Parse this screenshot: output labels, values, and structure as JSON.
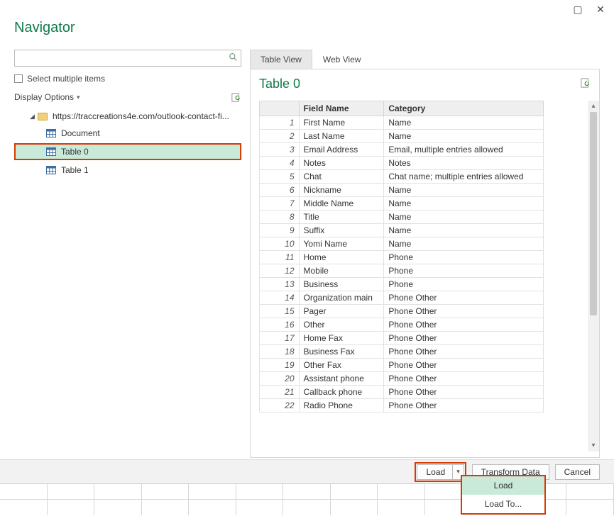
{
  "titlebar": {
    "maximize_glyph": "▢",
    "close_glyph": "✕"
  },
  "navigator": {
    "title": "Navigator",
    "search_placeholder": "",
    "select_multiple_label": "Select multiple items",
    "display_options_label": "Display Options"
  },
  "tree": {
    "url": "https://traccreations4e.com/outlook-contact-fi...",
    "items": [
      {
        "label": "Document",
        "selected": false
      },
      {
        "label": "Table 0",
        "selected": true
      },
      {
        "label": "Table 1",
        "selected": false
      }
    ]
  },
  "tabs": {
    "table_view": "Table View",
    "web_view": "Web View"
  },
  "preview": {
    "title": "Table 0",
    "columns": [
      "",
      "Field Name",
      "Category"
    ],
    "rows": [
      [
        1,
        "First Name",
        "Name"
      ],
      [
        2,
        "Last Name",
        "Name"
      ],
      [
        3,
        "Email Address",
        "Email, multiple entries allowed"
      ],
      [
        4,
        "Notes",
        "Notes"
      ],
      [
        5,
        "Chat",
        "Chat name;  multiple entries allowed"
      ],
      [
        6,
        "Nickname",
        "Name"
      ],
      [
        7,
        "Middle Name",
        "Name"
      ],
      [
        8,
        "Title",
        "Name"
      ],
      [
        9,
        "Suffix",
        "Name"
      ],
      [
        10,
        "Yomi Name",
        "Name"
      ],
      [
        11,
        "Home",
        "Phone"
      ],
      [
        12,
        "Mobile",
        "Phone"
      ],
      [
        13,
        "Business",
        "Phone"
      ],
      [
        14,
        "Organization main",
        "Phone Other"
      ],
      [
        15,
        "Pager",
        "Phone Other"
      ],
      [
        16,
        "Other",
        "Phone Other"
      ],
      [
        17,
        "Home Fax",
        "Phone Other"
      ],
      [
        18,
        "Business Fax",
        "Phone Other"
      ],
      [
        19,
        "Other Fax",
        "Phone Other"
      ],
      [
        20,
        "Assistant phone",
        "Phone Other"
      ],
      [
        21,
        "Callback phone",
        "Phone Other"
      ],
      [
        22,
        "Radio Phone",
        "Phone Other"
      ]
    ]
  },
  "footer": {
    "load": "Load",
    "transform": "Transform Data",
    "cancel": "Cancel"
  },
  "load_menu": {
    "load": "Load",
    "load_to": "Load To..."
  }
}
